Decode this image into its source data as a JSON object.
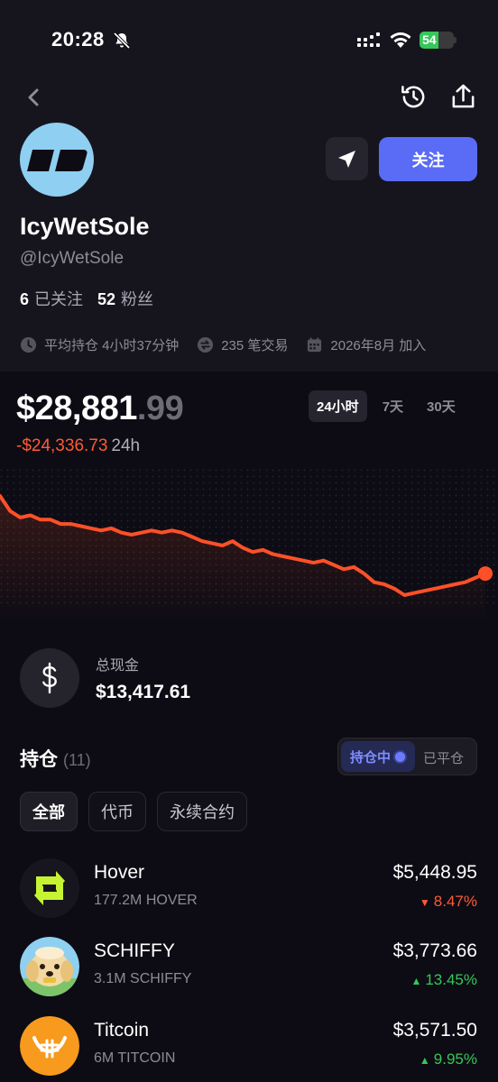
{
  "status": {
    "time": "20:28",
    "battery": "54",
    "battery_level": 0.54
  },
  "profile": {
    "display_name": "IcyWetSole",
    "handle": "@IcyWetSole",
    "following_count": "6",
    "following_label": "已关注",
    "followers_count": "52",
    "followers_label": "粉丝",
    "follow_button": "关注",
    "avg_hold": "平均持仓 4小时37分钟",
    "trades": "235 笔交易",
    "joined": "2026年8月 加入"
  },
  "portfolio": {
    "balance_main": "$28,881",
    "balance_cents": ".99",
    "change_value": "-$24,336.73",
    "change_period": "24h",
    "ranges": [
      "24小时",
      "7天",
      "30天"
    ],
    "active_range": "24小时"
  },
  "chart_data": {
    "type": "line",
    "x": [
      0,
      1,
      2,
      3,
      4,
      5,
      6,
      7,
      8,
      9,
      10,
      11,
      12,
      13,
      14,
      15,
      16,
      17,
      18,
      19,
      20,
      21,
      22,
      23,
      24,
      25,
      26,
      27,
      28,
      29,
      30,
      31,
      32,
      33,
      34,
      35,
      36,
      37,
      38,
      39,
      40,
      41,
      42,
      43,
      44,
      45,
      46,
      47,
      48
    ],
    "values": [
      100,
      93,
      90,
      91,
      89,
      89,
      87,
      87,
      86,
      85,
      84,
      85,
      83,
      82,
      83,
      84,
      83,
      84,
      83,
      81,
      79,
      78,
      77,
      79,
      76,
      74,
      75,
      73,
      72,
      71,
      70,
      69,
      70,
      68,
      66,
      67,
      64,
      60,
      59,
      57,
      54,
      55,
      56,
      57,
      58,
      59,
      60,
      62,
      64
    ],
    "series_color": "#ff5028",
    "xlabel": "",
    "ylabel": "",
    "grid": false,
    "legend": "none"
  },
  "cash": {
    "label": "总现金",
    "value": "$13,417.61",
    "icon": "dollar-icon"
  },
  "holdings": {
    "title": "持仓",
    "count": "(11)",
    "open_label": "持仓中",
    "closed_label": "已平仓",
    "filters": [
      "全部",
      "代币",
      "永续合约"
    ],
    "active_filter": "全部",
    "items": [
      {
        "name": "Hover",
        "amount": "177.2M HOVER",
        "value": "$5,448.95",
        "change": "8.47%",
        "direction": "down",
        "arrow": "▼",
        "icon": "hover-logo-icon"
      },
      {
        "name": "SCHIFFY",
        "amount": "3.1M SCHIFFY",
        "value": "$3,773.66",
        "change": "13.45%",
        "direction": "up",
        "arrow": "▲",
        "icon": "schiffy-dog-icon"
      },
      {
        "name": "Titcoin",
        "amount": "6M TITCOIN",
        "value": "$3,571.50",
        "change": "9.95%",
        "direction": "up",
        "arrow": "▲",
        "icon": "titcoin-logo-icon"
      }
    ]
  },
  "colors": {
    "accent": "#5a6cf5",
    "negative": "#ff5a36",
    "positive": "#35c759",
    "background": "#0d0c14"
  }
}
